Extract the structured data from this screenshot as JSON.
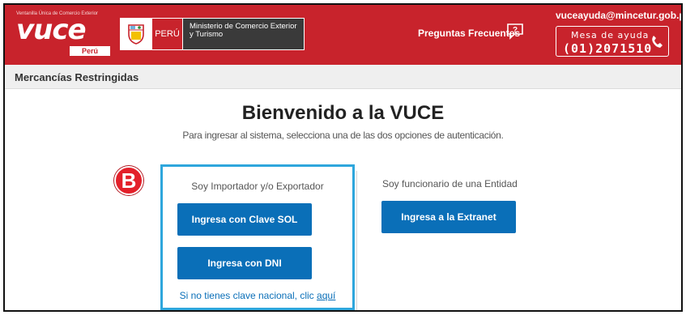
{
  "header": {
    "logo_tagline": "Ventanilla Única de Comercio Exterior",
    "logo_word": "vuce",
    "logo_country": "Perú",
    "gov_country": "PERÚ",
    "ministry": "Ministerio de Comercio Exterior y Turismo",
    "faq_label": "Preguntas Frecuentes",
    "email": "vuceayuda@mincetur.gob.pe",
    "help_title": "Mesa de ayuda",
    "help_phone": "(01)2071510",
    "brand_color": "#c8232c"
  },
  "subbar": {
    "title": "Mercancías Restringidas"
  },
  "main": {
    "title": "Bienvenido a la VUCE",
    "subtitle": "Para ingresar al sistema, selecciona una de las dos opciones de autenticación.",
    "badge": "B",
    "left": {
      "label": "Soy Importador y/o Exportador",
      "btn_sol": "Ingresa con Clave SOL",
      "btn_dni": "Ingresa con DNI",
      "link_prefix": "Si no tienes clave nacional, clic",
      "link_text": "aquí"
    },
    "right": {
      "label": "Soy funcionario de una Entidad",
      "btn_extranet": "Ingresa a la Extranet"
    },
    "button_color": "#0a6fb8",
    "highlight_color": "#2ea6dc"
  }
}
